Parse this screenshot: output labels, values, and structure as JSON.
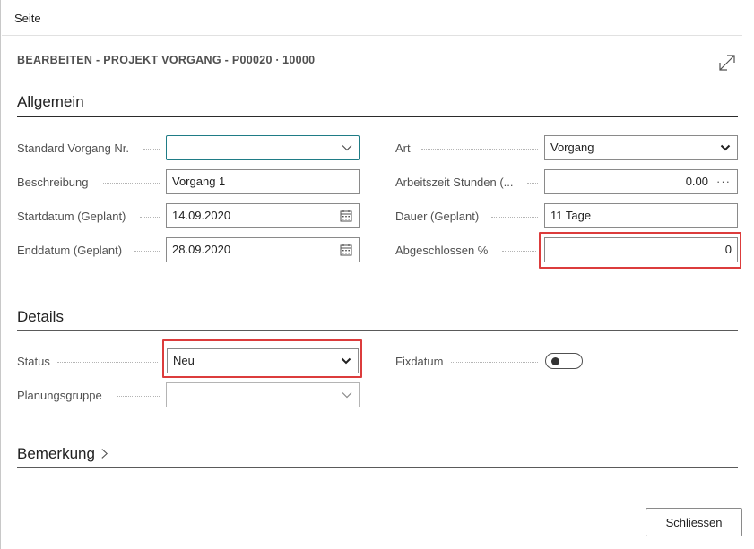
{
  "page": {
    "header_label": "Seite",
    "title": "BEARBEITEN - PROJEKT VORGANG - P00020 ∙ 10000"
  },
  "icons": {
    "expand": "expand-icon",
    "dropdown": "chevron-down-icon",
    "calendar": "calendar-icon",
    "more": "more-icon"
  },
  "colors": {
    "highlight": "#dc3c3c",
    "focus": "#1f7c86"
  },
  "general": {
    "title": "Allgemein",
    "standard_task_no": {
      "label": "Standard Vorgang Nr.",
      "value": ""
    },
    "description": {
      "label": "Beschreibung",
      "value": "Vorgang 1"
    },
    "start_date": {
      "label": "Startdatum (Geplant)",
      "value": "14.09.2020"
    },
    "end_date": {
      "label": "Enddatum (Geplant)",
      "value": "28.09.2020"
    },
    "type": {
      "label": "Art",
      "value": "Vorgang"
    },
    "work_hours": {
      "label": "Arbeitszeit Stunden (...",
      "value": "0.00",
      "more": "···"
    },
    "duration": {
      "label": "Dauer (Geplant)",
      "value": "11 Tage"
    },
    "completed_pct": {
      "label": "Abgeschlossen %",
      "value": "0"
    }
  },
  "details": {
    "title": "Details",
    "status": {
      "label": "Status",
      "value": "Neu"
    },
    "planning_group": {
      "label": "Planungsgruppe",
      "value": ""
    },
    "fixed_date": {
      "label": "Fixdatum",
      "value": false
    }
  },
  "remarks": {
    "title": "Bemerkung"
  },
  "buttons": {
    "close": "Schliessen"
  }
}
